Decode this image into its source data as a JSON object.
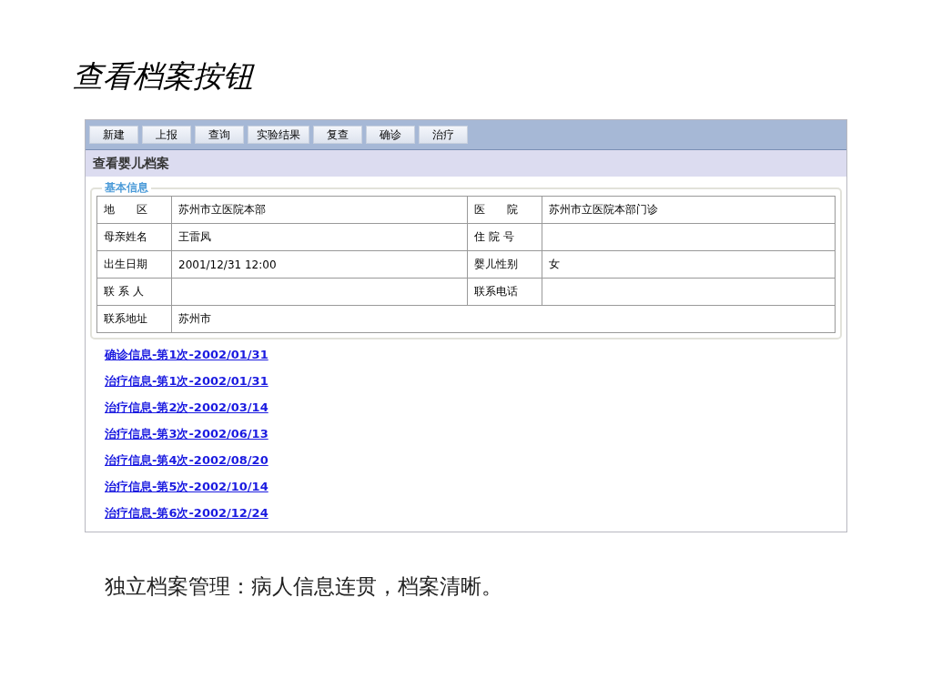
{
  "slide_title": "查看档案按钮",
  "toolbar": {
    "buttons": [
      "新建",
      "上报",
      "查询",
      "实验结果",
      "复查",
      "确诊",
      "治疗"
    ]
  },
  "page_heading": "查看婴儿档案",
  "basic_info": {
    "legend": "基本信息",
    "rows": [
      [
        {
          "label": "地　　区",
          "value": "苏州市立医院本部"
        },
        {
          "label": "医　　院",
          "value": "苏州市立医院本部门诊"
        }
      ],
      [
        {
          "label": "母亲姓名",
          "value": "王雷凤"
        },
        {
          "label": "住 院 号"
        }
      ],
      [
        {
          "label": "出生日期",
          "value": "2001/12/31 12:00"
        },
        {
          "label": "婴儿性别",
          "value": "女"
        }
      ],
      [
        {
          "label": "联 系 人"
        },
        {
          "label": "联系电话"
        }
      ],
      [
        {
          "label": "联系地址",
          "value": "苏州市"
        }
      ]
    ]
  },
  "record_links": [
    "确诊信息-第1次-2002/01/31",
    "治疗信息-第1次-2002/01/31",
    "治疗信息-第2次-2002/03/14",
    "治疗信息-第3次-2002/06/13",
    "治疗信息-第4次-2002/08/20",
    "治疗信息-第5次-2002/10/14",
    "治疗信息-第6次-2002/12/24"
  ],
  "caption": "独立档案管理：病人信息连贯，档案清晰。"
}
